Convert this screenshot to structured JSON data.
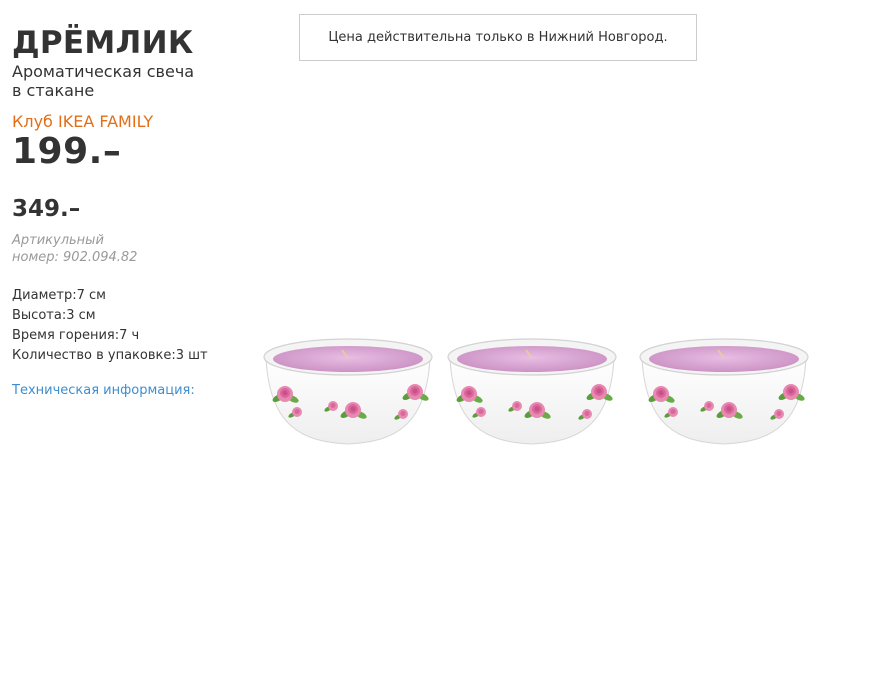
{
  "product": {
    "name": "ДРЁМЛИК",
    "subtitle_line1": "Ароматическая свеча",
    "subtitle_line2": "в стакане",
    "family_label": "Клуб IKEA FAMILY",
    "family_price": "199.–",
    "regular_price": "349.–",
    "article_line1": "Артикульный",
    "article_line2": "номер: 902.094.82"
  },
  "specs": [
    "Диаметр:7 см",
    "Высота:3 см",
    "Время горения:7 ч",
    "Количество в упаковке:3 шт"
  ],
  "tech_link_label": "Техническая информация:",
  "notice_text": "Цена действительна только в Нижний Новгород.",
  "colors": {
    "family_accent": "#e26f17",
    "link": "#3d8ed0",
    "wax": "#d9a8d4",
    "rose": "#e06f9f",
    "leaf": "#5a9e3a"
  },
  "image": {
    "icon": "candle-bowls-image",
    "bowl_count": 3
  }
}
